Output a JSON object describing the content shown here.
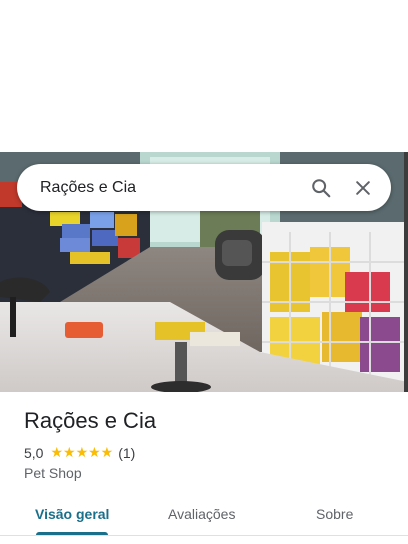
{
  "search": {
    "query": "Rações e Cia"
  },
  "place": {
    "name": "Rações e Cia",
    "rating": "5,0",
    "stars": "★★★★★",
    "reviews": "(1)",
    "category": "Pet Shop"
  },
  "tabs": [
    {
      "label": "Visão geral",
      "active": true
    },
    {
      "label": "Avaliações",
      "active": false
    },
    {
      "label": "Sobre",
      "active": false
    }
  ],
  "colors": {
    "accent": "#1a6f8a",
    "star": "#fbbc04"
  }
}
